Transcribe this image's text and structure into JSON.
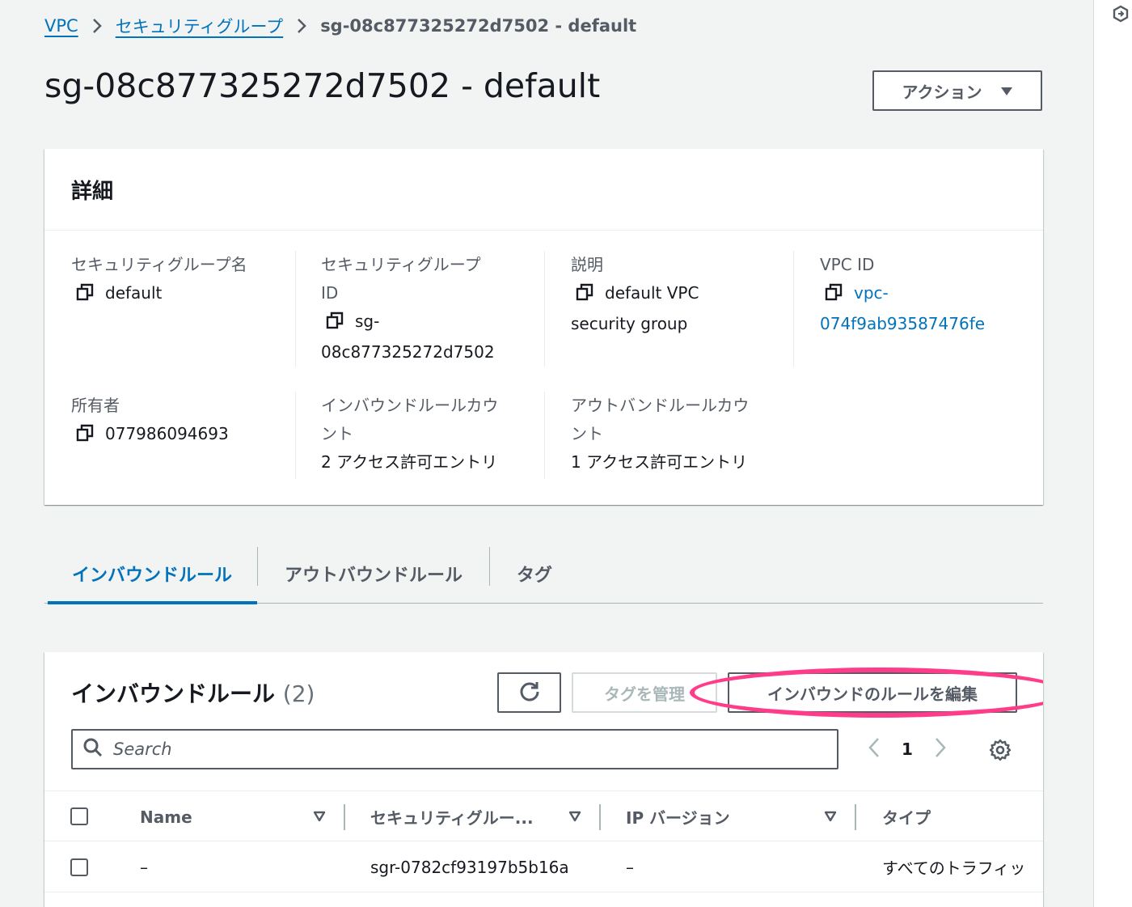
{
  "breadcrumb": {
    "items": [
      "VPC",
      "セキュリティグループ"
    ],
    "current": "sg-08c877325272d7502 - default"
  },
  "page": {
    "title": "sg-08c877325272d7502 - default",
    "actions_label": "アクション"
  },
  "details": {
    "heading": "詳細",
    "sg_name_label": "セキュリティグループ名",
    "sg_name_value": "default",
    "sg_id_label_1": "セキュリティグループ",
    "sg_id_label_2": "ID",
    "sg_id_value_1": "sg-",
    "sg_id_value_2": "08c877325272d7502",
    "description_label": "説明",
    "description_value_1": "default VPC",
    "description_value_2": "security group",
    "vpc_id_label": "VPC ID",
    "vpc_id_value_1": "vpc-",
    "vpc_id_value_2": "074f9ab93587476fe",
    "owner_label": "所有者",
    "owner_value": "077986094693",
    "inbound_count_label_1": "インバウンドルールカウ",
    "inbound_count_label_2": "ント",
    "inbound_count_value": "2 アクセス許可エントリ",
    "outbound_count_label_1": "アウトバンドルールカウ",
    "outbound_count_label_2": "ント",
    "outbound_count_value": "1 アクセス許可エントリ"
  },
  "tabs": [
    {
      "label": "インバウンドルール"
    },
    {
      "label": "アウトバウンドルール"
    },
    {
      "label": "タグ"
    }
  ],
  "rules": {
    "title": "インバウンドルール",
    "count": "(2)",
    "manage_tags_label": "タグを管理",
    "edit_rules_label": "インバウンドのルールを編集",
    "search_placeholder": "Search",
    "page_number": "1",
    "columns": [
      "Name",
      "セキュリティグルー...",
      "IP バージョン",
      "タイプ"
    ],
    "rows": [
      {
        "name": "–",
        "sg_rule_id": "sgr-0782cf93197b5b16a",
        "ip_version": "–",
        "type": "すべてのトラフィッ"
      }
    ]
  },
  "colors": {
    "link": "#0073bb",
    "highlight": "#ff3c8a"
  }
}
